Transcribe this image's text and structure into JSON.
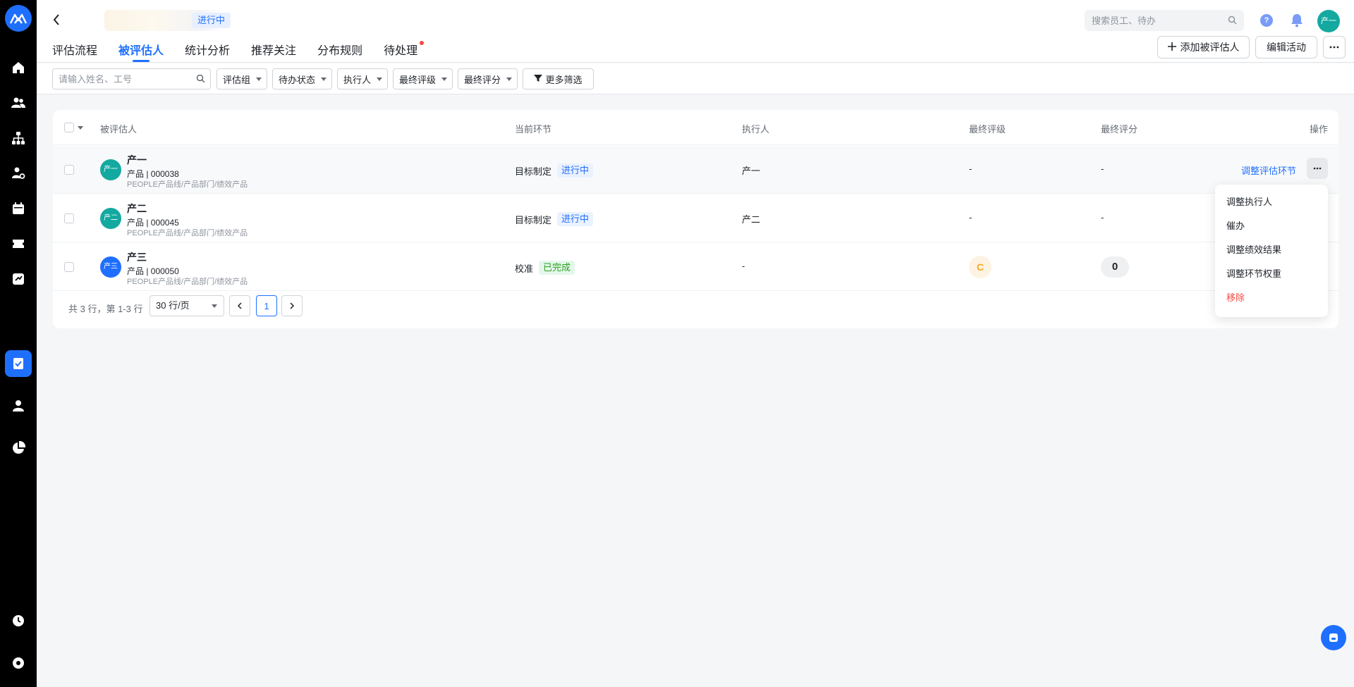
{
  "header": {
    "status": "进行中",
    "tabs": [
      {
        "label": "评估流程"
      },
      {
        "label": "被评估人"
      },
      {
        "label": "统计分析"
      },
      {
        "label": "推荐关注"
      },
      {
        "label": "分布规则"
      },
      {
        "label": "待处理"
      }
    ],
    "active_tab": "被评估人",
    "search_placeholder": "搜索员工、待办",
    "help_label": "?",
    "user_avatar": "产一",
    "add_button": "添加被评估人",
    "edit_button": "编辑活动"
  },
  "filters": {
    "name_placeholder": "请输入姓名、工号",
    "selects": [
      "评估组",
      "待办状态",
      "执行人",
      "最终评级",
      "最终评分"
    ],
    "more": "更多筛选"
  },
  "table": {
    "columns": [
      "被评估人",
      "当前环节",
      "执行人",
      "最终评级",
      "最终评分",
      "操作"
    ],
    "rows": [
      {
        "avatar": "产一",
        "avatar_color": "#14a9a0",
        "name": "产一",
        "meta": "产品 | 000038",
        "dept": "PEOPLE产品线/产品部门/绩效产品",
        "stage": "目标制定",
        "stage_status": "进行中",
        "executor": "产一",
        "grade": "-",
        "score": "-",
        "action": "调整评估环节"
      },
      {
        "avatar": "产二",
        "avatar_color": "#14a9a0",
        "name": "产二",
        "meta": "产品 | 000045",
        "dept": "PEOPLE产品线/产品部门/绩效产品",
        "stage": "目标制定",
        "stage_status": "进行中",
        "executor": "产二",
        "grade": "-",
        "score": "-"
      },
      {
        "avatar": "产三",
        "avatar_color": "#1f6fff",
        "name": "产三",
        "meta": "产品 | 000050",
        "dept": "PEOPLE产品线/产品部门/绩效产品",
        "stage": "校准",
        "stage_status": "已完成",
        "executor": "-",
        "grade": "C",
        "score": "0"
      }
    ]
  },
  "pagination": {
    "info": "共 3 行，第 1-3 行",
    "page_size": "30 行/页",
    "current_page": "1"
  },
  "menu": {
    "items": [
      "调整执行人",
      "催办",
      "调整绩效结果",
      "调整环节权重",
      "移除"
    ]
  },
  "colors": {
    "accent": "#1f6fff",
    "success": "#2ea121",
    "danger": "#f54a45",
    "grade_c": "#f5a623"
  }
}
